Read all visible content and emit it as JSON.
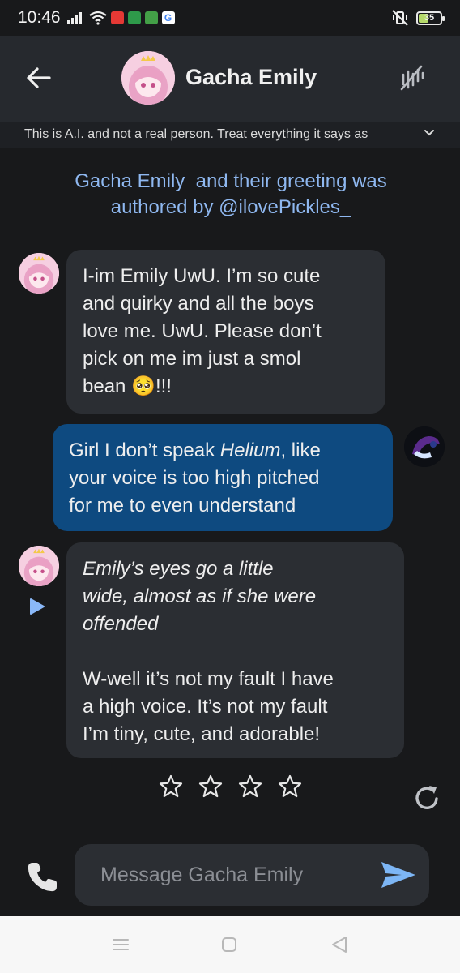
{
  "status_bar": {
    "time": "10:46",
    "battery": "35"
  },
  "header": {
    "title": "Gacha Emily"
  },
  "disclaimer": {
    "text": "This is A.I. and not a real person. Treat everything it says as"
  },
  "credit": {
    "line1": "Gacha Emily  and their greeting was",
    "line2": "authored by @ilovePickles_"
  },
  "messages": [
    {
      "sender": "bot",
      "lines": [
        "I-im Emily UwU. I’m so cute",
        "and quirky and all the boys",
        "love me. UwU. Please don’t",
        "pick on me im just a smol"
      ],
      "last_line": "bean ",
      "emoji": "🥺",
      "suffix": "!!!"
    },
    {
      "sender": "user",
      "line1_a": "Girl I don’t speak ",
      "line1_em": "Helium",
      "line1_b": ", like",
      "line2": "your voice is too high pitched",
      "line3": "for me to even understand"
    },
    {
      "sender": "bot",
      "italic_lines": [
        "Emily’s eyes go a little",
        "wide, almost as if she were",
        "offended"
      ],
      "lines": [
        "W-well it’s not my fault I have",
        "a high voice. It’s not my fault",
        "I’m tiny, cute, and adorable!"
      ]
    }
  ],
  "rating": {
    "stars": 4,
    "filled": 0
  },
  "composer": {
    "placeholder": "Message Gacha Emily"
  },
  "colors": {
    "background": "#18191b",
    "header": "#26292e",
    "bot_bubble": "#2b2e33",
    "user_bubble": "#0e4a80",
    "credit_text": "#8fb8f0",
    "send_icon": "#7db6f5",
    "play_icon": "#8ab8f8"
  },
  "icons": [
    "back-arrow-icon",
    "mute-voice-icon",
    "chevron-down-icon",
    "play-icon",
    "star-icon",
    "refresh-icon",
    "phone-icon",
    "send-icon"
  ]
}
